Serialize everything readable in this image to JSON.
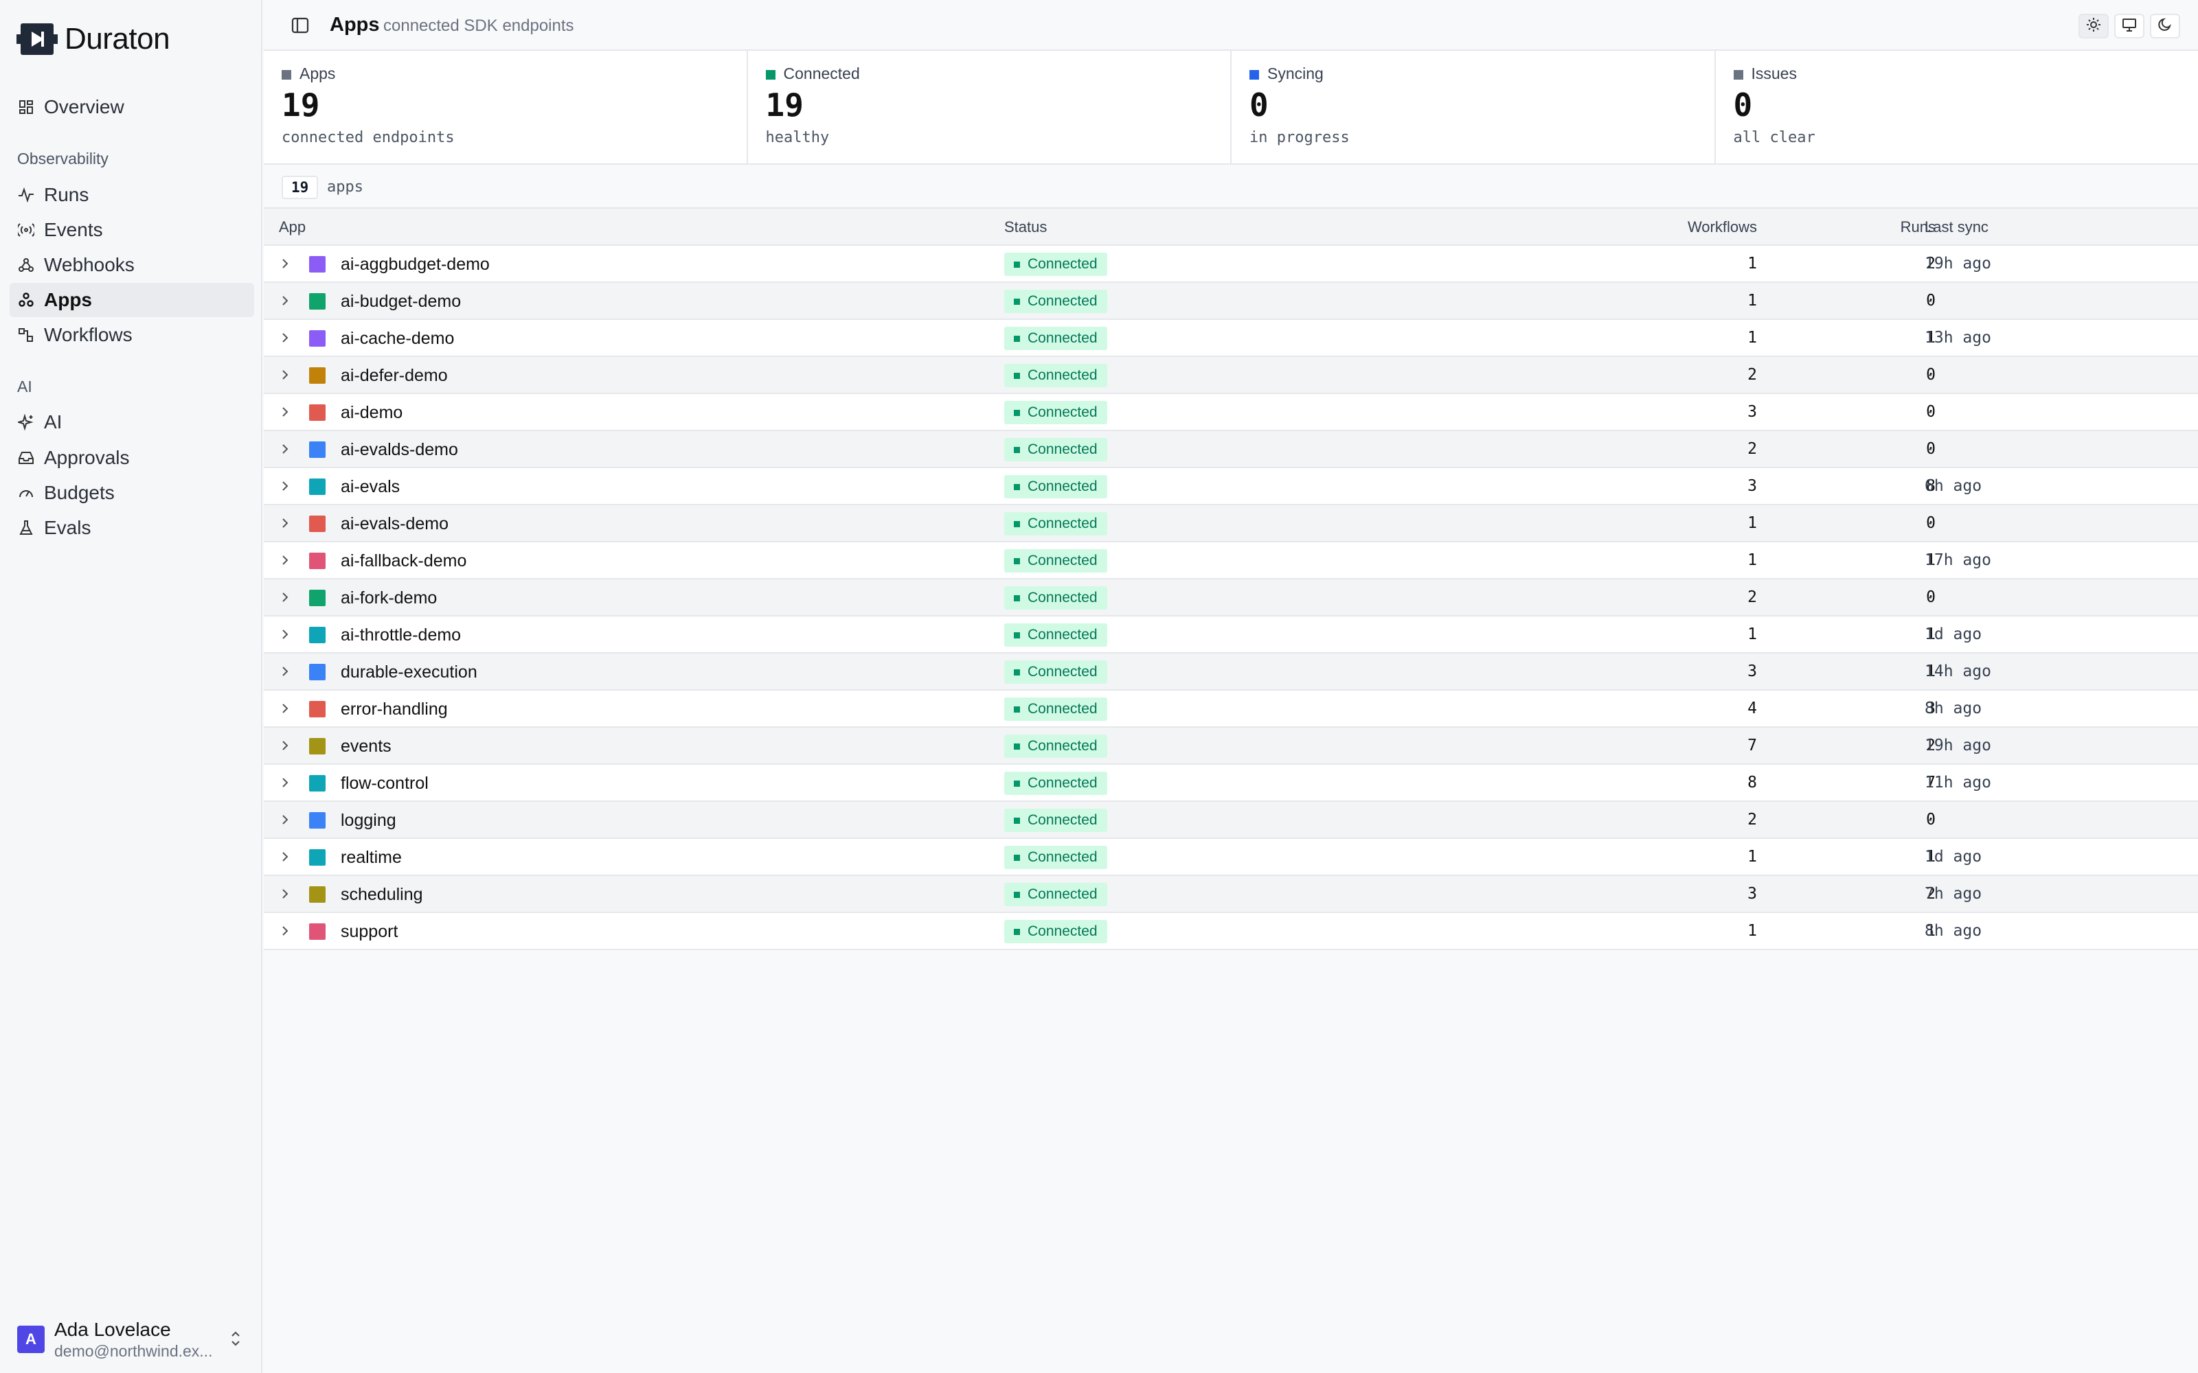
{
  "brand": {
    "name": "Duraton"
  },
  "sidebar": {
    "top": [
      {
        "label": "Overview",
        "icon": "overview-icon"
      }
    ],
    "sections": [
      {
        "title": "Observability",
        "items": [
          {
            "label": "Runs",
            "icon": "activity-icon"
          },
          {
            "label": "Events",
            "icon": "broadcast-icon"
          },
          {
            "label": "Webhooks",
            "icon": "webhook-icon"
          },
          {
            "label": "Apps",
            "icon": "apps-icon",
            "active": true
          },
          {
            "label": "Workflows",
            "icon": "workflow-icon"
          }
        ]
      },
      {
        "title": "AI",
        "items": [
          {
            "label": "AI",
            "icon": "sparkles-icon"
          },
          {
            "label": "Approvals",
            "icon": "inbox-icon"
          },
          {
            "label": "Budgets",
            "icon": "gauge-icon"
          },
          {
            "label": "Evals",
            "icon": "flask-icon"
          }
        ]
      }
    ],
    "user": {
      "initial": "A",
      "name": "Ada Lovelace",
      "email": "demo@northwind.ex..."
    }
  },
  "header": {
    "title": "Apps",
    "subtitle": "connected SDK endpoints"
  },
  "stats": [
    {
      "label": "Apps",
      "value": "19",
      "sub": "connected endpoints",
      "color": "#6b7280"
    },
    {
      "label": "Connected",
      "value": "19",
      "sub": "healthy",
      "color": "#059669"
    },
    {
      "label": "Syncing",
      "value": "0",
      "sub": "in progress",
      "color": "#2563eb"
    },
    {
      "label": "Issues",
      "value": "0",
      "sub": "all clear",
      "color": "#6b7280"
    }
  ],
  "count": {
    "value": "19",
    "label": "apps"
  },
  "table": {
    "columns": {
      "app": "App",
      "status": "Status",
      "workflows": "Workflows",
      "runs": "Runs",
      "last_sync": "Last sync"
    },
    "rows": [
      {
        "name": "ai-aggbudget-demo",
        "color": "#8b5cf6",
        "status": "Connected",
        "workflows": "1",
        "runs": "2",
        "last_sync": "19h ago"
      },
      {
        "name": "ai-budget-demo",
        "color": "#10a36b",
        "status": "Connected",
        "workflows": "1",
        "runs": "0",
        "last_sync": "-"
      },
      {
        "name": "ai-cache-demo",
        "color": "#8b5cf6",
        "status": "Connected",
        "workflows": "1",
        "runs": "1",
        "last_sync": "13h ago"
      },
      {
        "name": "ai-defer-demo",
        "color": "#c2820a",
        "status": "Connected",
        "workflows": "2",
        "runs": "0",
        "last_sync": "-"
      },
      {
        "name": "ai-demo",
        "color": "#e05a4f",
        "status": "Connected",
        "workflows": "3",
        "runs": "0",
        "last_sync": "-"
      },
      {
        "name": "ai-evalds-demo",
        "color": "#3b82f6",
        "status": "Connected",
        "workflows": "2",
        "runs": "0",
        "last_sync": "-"
      },
      {
        "name": "ai-evals",
        "color": "#0ea5b7",
        "status": "Connected",
        "workflows": "3",
        "runs": "8",
        "last_sync": "6h ago"
      },
      {
        "name": "ai-evals-demo",
        "color": "#e05a4f",
        "status": "Connected",
        "workflows": "1",
        "runs": "0",
        "last_sync": "-"
      },
      {
        "name": "ai-fallback-demo",
        "color": "#e05478",
        "status": "Connected",
        "workflows": "1",
        "runs": "1",
        "last_sync": "17h ago"
      },
      {
        "name": "ai-fork-demo",
        "color": "#10a36b",
        "status": "Connected",
        "workflows": "2",
        "runs": "0",
        "last_sync": "-"
      },
      {
        "name": "ai-throttle-demo",
        "color": "#0ea5b7",
        "status": "Connected",
        "workflows": "1",
        "runs": "1",
        "last_sync": "1d ago"
      },
      {
        "name": "durable-execution",
        "color": "#3b82f6",
        "status": "Connected",
        "workflows": "3",
        "runs": "1",
        "last_sync": "14h ago"
      },
      {
        "name": "error-handling",
        "color": "#e05a4f",
        "status": "Connected",
        "workflows": "4",
        "runs": "3",
        "last_sync": "8h ago"
      },
      {
        "name": "events",
        "color": "#a39416",
        "status": "Connected",
        "workflows": "7",
        "runs": "2",
        "last_sync": "19h ago"
      },
      {
        "name": "flow-control",
        "color": "#0ea5b7",
        "status": "Connected",
        "workflows": "8",
        "runs": "7",
        "last_sync": "11h ago"
      },
      {
        "name": "logging",
        "color": "#3b82f6",
        "status": "Connected",
        "workflows": "2",
        "runs": "0",
        "last_sync": "-"
      },
      {
        "name": "realtime",
        "color": "#0ea5b7",
        "status": "Connected",
        "workflows": "1",
        "runs": "1",
        "last_sync": "1d ago"
      },
      {
        "name": "scheduling",
        "color": "#a39416",
        "status": "Connected",
        "workflows": "3",
        "runs": "2",
        "last_sync": "7h ago"
      },
      {
        "name": "support",
        "color": "#e05478",
        "status": "Connected",
        "workflows": "1",
        "runs": "1",
        "last_sync": "8h ago"
      }
    ]
  }
}
